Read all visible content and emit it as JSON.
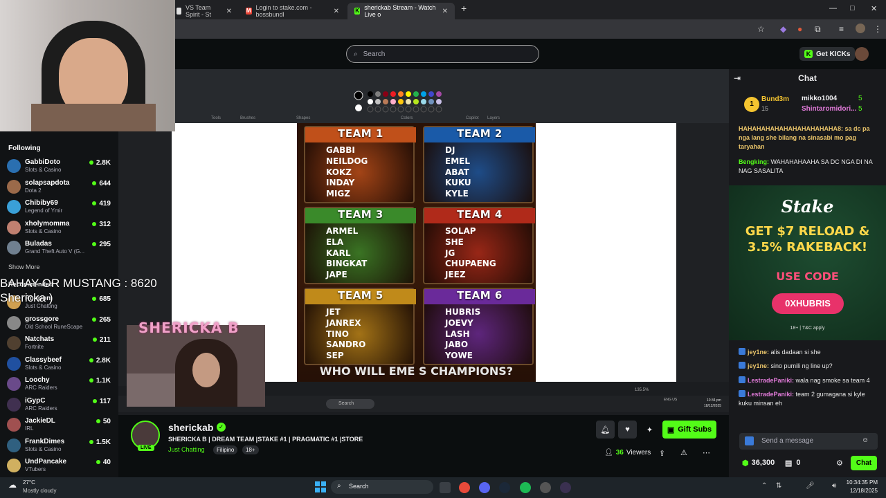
{
  "browser": {
    "tabs": [
      {
        "label": "VS Team Spirit - St"
      },
      {
        "label": "Login to stake.com - bossbundl"
      },
      {
        "label": "sherickab Stream - Watch Live o"
      }
    ],
    "new_tab": "+",
    "minimize": "—",
    "maximize": "□",
    "close": "✕"
  },
  "kick": {
    "search_placeholder": "Search",
    "get_kicks": "Get KICKs"
  },
  "sidebar": {
    "following_label": "Following",
    "channels": [
      {
        "name": "GabbiDoto",
        "category": "Slots & Casino",
        "viewers": "2.8K",
        "color": "#2a6fb0"
      },
      {
        "name": "solapsapdota",
        "category": "Dota 2",
        "viewers": "644",
        "color": "#9b6a4a"
      },
      {
        "name": "Chibiby69",
        "category": "Legend of Ymir",
        "viewers": "419",
        "color": "#3aa0d8"
      },
      {
        "name": "xholymomma",
        "category": "Slots & Casino",
        "viewers": "312",
        "color": "#c08070"
      },
      {
        "name": "Buladas",
        "category": "Grand Theft Auto V (G...",
        "viewers": "295",
        "color": "#708090"
      }
    ],
    "show_more": "Show More",
    "recommended_label": "Recommended",
    "recommended": [
      {
        "name": "Ponpon",
        "category": "Just Chatting",
        "viewers": "685",
        "color": "#d0a050"
      },
      {
        "name": "grossgore",
        "category": "Old School RuneScape",
        "viewers": "265",
        "color": "#888"
      },
      {
        "name": "Natchats",
        "category": "Fortnite",
        "viewers": "211",
        "color": "#504030"
      },
      {
        "name": "Classybeef",
        "category": "Slots & Casino",
        "viewers": "2.8K",
        "color": "#2050a0"
      },
      {
        "name": "Loochy",
        "category": "ARC Raiders",
        "viewers": "1.1K",
        "color": "#6a4a8a"
      },
      {
        "name": "iGypC",
        "category": "ARC Raiders",
        "viewers": "117",
        "color": "#403050"
      },
      {
        "name": "JackieDL",
        "category": "IRL",
        "viewers": "50",
        "color": "#a05050"
      },
      {
        "name": "FrankDimes",
        "category": "Slots & Casino",
        "viewers": "1.5K",
        "color": "#306080"
      },
      {
        "name": "UndPancake",
        "category": "VTubers",
        "viewers": "40",
        "color": "#d0b060"
      }
    ]
  },
  "overlay": {
    "line1": "BAHAY OR MUSTANG : 8620",
    "line2": "Shericka )",
    "cam_title": "SHERICKA B"
  },
  "stream_content": {
    "teams": [
      {
        "title": "TEAM 1",
        "members": [
          "GABBI",
          "NEILDOG",
          "KOKZ",
          "INDAY",
          "MIGZ"
        ],
        "color": "#c0501a"
      },
      {
        "title": "TEAM 2",
        "members": [
          "DJ",
          "EMEL",
          "ABAT",
          "KUKU",
          "KYLE"
        ],
        "color": "#1a5aa8"
      },
      {
        "title": "TEAM 3",
        "members": [
          "ARMEL",
          "ELA",
          "KARL",
          "BINGKAT",
          "JAPE"
        ],
        "color": "#3a8a2a"
      },
      {
        "title": "TEAM 4",
        "members": [
          "SOLAP",
          "SHE",
          "JG",
          "CHUPAENG",
          "JEEZ"
        ],
        "color": "#b02a1a"
      },
      {
        "title": "TEAM 5",
        "members": [
          "JET",
          "JANREX",
          "TINO",
          "SANDRO",
          "SEP"
        ],
        "color": "#c08a1a"
      },
      {
        "title": "TEAM 6",
        "members": [
          "HUBRIS",
          "JOEVY",
          "LASH",
          "JABO",
          "YOWE"
        ],
        "color": "#6a2a9a"
      }
    ],
    "banner": "WHO WILL EME  S CHAMPIONS?",
    "paint_labels": {
      "tools": "Tools",
      "brushes": "Brushes",
      "shapes": "Shapes",
      "colors": "Colors",
      "copilot": "Copilot",
      "layers": "Layers"
    },
    "zoom": "135.5%",
    "inner_search": "Search",
    "inner_time": "10:34 pm",
    "inner_date": "18/12/2025",
    "inner_lang": "ENG US"
  },
  "stream_info": {
    "channel": "sherickab",
    "title": "SHERICKA B | DREAM TEAM |STAKE #1 | PRAGMATIC #1 |STORE",
    "category": "Just Chatting",
    "tags": [
      "Filipino",
      "18+"
    ],
    "live_label": "LIVE",
    "viewers": "36",
    "viewers_label": "Viewers",
    "gift_subs": "Gift Subs"
  },
  "chat": {
    "header": "Chat",
    "leaderboard": [
      {
        "rank": "1",
        "name": "Bund3m",
        "count": "15"
      },
      {
        "name": "mikko1004",
        "count": "5"
      },
      {
        "name": "Shintaromidori...",
        "count": "5"
      }
    ],
    "messages_top": [
      {
        "user": "",
        "text": "HAHAHAHAHAHAHAHAHAHAHA8: sa dc pa nga lang she bilang na sinasabi mo pag taryahan"
      },
      {
        "user": "Bengking:",
        "text": "WAHAHAHAAHA SA DC NGA DI NA NAG SASALITA"
      },
      {
        "user": "jey1ne:",
        "text": ""
      }
    ],
    "ad": {
      "brand": "Stake",
      "headline1": "GET $7 RELOAD &",
      "headline2": "3.5% RAKEBACK!",
      "use_code": "USE CODE",
      "code": "0XHUBRIS",
      "terms": "18+ | T&C apply"
    },
    "messages": [
      {
        "user": "jey1ne:",
        "text": "alis dadaan si she",
        "color": "#e9c46a"
      },
      {
        "user": "jey1ne:",
        "text": "sino pumili ng line up?",
        "color": "#e9c46a"
      },
      {
        "user": "LestradePaniki:",
        "text": "wala nag smoke sa team 4",
        "color": "#e07ad8"
      },
      {
        "user": "LestradePaniki:",
        "text": "team 2 gumagana si kyle kuku minsan eh",
        "color": "#e07ad8"
      }
    ],
    "input_placeholder": "Send a message",
    "points": "36,300",
    "subs": "0",
    "chat_button": "Chat"
  },
  "taskbar": {
    "weather_temp": "27°C",
    "weather_desc": "Mostly cloudy",
    "search": "Search",
    "time": "10:34:35 PM",
    "date": "12/18/2025"
  }
}
